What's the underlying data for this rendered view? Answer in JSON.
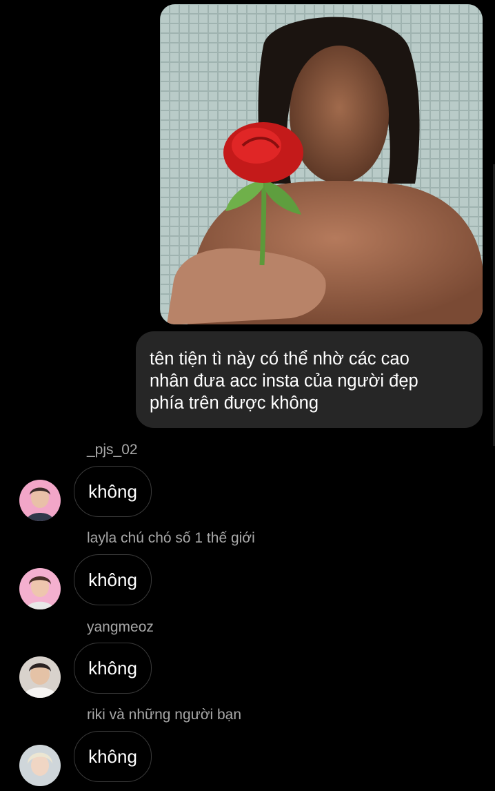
{
  "conversation": {
    "sent_photo_alt": "photo message",
    "sent_text": "tên tiện tì này có thể nhờ các cao nhân đưa acc insta của người đẹp phía trên được không",
    "sent_lines": [
      "tên tiện tì này có thể nhờ các cao",
      "nhân đưa acc insta của người đẹp",
      "phía trên được không"
    ],
    "replies": [
      {
        "sender": "_pjs_02",
        "text": "không",
        "avatar_icon": "avatar-photo-pink"
      },
      {
        "sender": "layla chú chó số 1 thế giới",
        "text": "không",
        "avatar_icon": "avatar-photo-pink"
      },
      {
        "sender": "yangmeoz",
        "text": "không",
        "avatar_icon": "avatar-photo-plush"
      },
      {
        "sender": "riki và những người bạn",
        "text": "không",
        "avatar_icon": "avatar-photo-blond"
      }
    ]
  },
  "colors": {
    "background": "#000000",
    "outgoing_bubble": "#262626",
    "incoming_bubble_border": "#3a3a3a",
    "sender_name": "#a8a8a8",
    "text": "#ffffff"
  }
}
